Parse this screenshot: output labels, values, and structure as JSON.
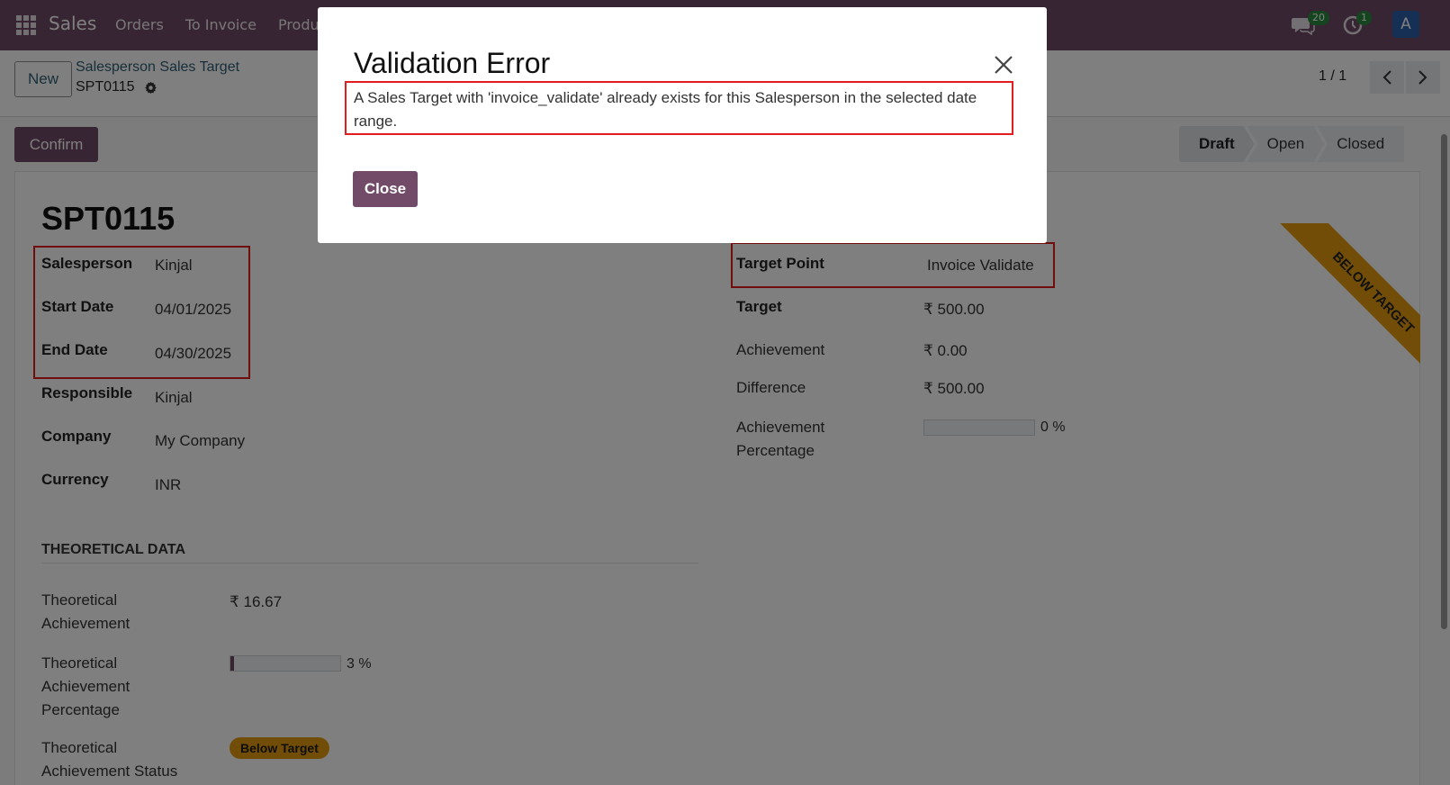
{
  "navbar": {
    "brand": "Sales",
    "menu": [
      "Orders",
      "To Invoice",
      "Produ"
    ],
    "chat_badge": "20",
    "activity_badge": "1",
    "avatar_letter": "A"
  },
  "control_panel": {
    "new_label": "New",
    "breadcrumb": "Salesperson Sales Target",
    "record_name": "SPT0115",
    "pager": "1 / 1"
  },
  "statusbar": {
    "confirm_label": "Confirm",
    "stages": [
      "Draft",
      "Open",
      "Closed"
    ],
    "active_stage": "Draft"
  },
  "form": {
    "title": "SPT0115",
    "ribbon": "BELOW TARGET",
    "left_fields": [
      {
        "label": "Salesperson",
        "value": "Kinjal"
      },
      {
        "label": "Start Date",
        "value": "04/01/2025"
      },
      {
        "label": "End Date",
        "value": "04/30/2025"
      },
      {
        "label": "Responsible",
        "value": "Kinjal"
      },
      {
        "label": "Company",
        "value": "My Company"
      },
      {
        "label": "Currency",
        "value": "INR"
      }
    ],
    "right_fields": [
      {
        "label": "Target Point",
        "value": "Invoice Validate"
      },
      {
        "label": "Target",
        "value": "₹ 500.00"
      },
      {
        "label": "Achievement",
        "value": "₹ 0.00"
      },
      {
        "label": "Difference",
        "value": "₹ 500.00"
      },
      {
        "label": "Achievement Percentage",
        "value": "0 %",
        "progress": 0
      }
    ],
    "theoretical": {
      "section_title": "THEORETICAL DATA",
      "achievement_label": "Theoretical Achievement",
      "achievement_value": "₹ 16.67",
      "percentage_label": "Theoretical Achievement Percentage",
      "percentage_value": "3 %",
      "percentage_progress": 3,
      "status_label": "Theoretical Achievement Status",
      "status_value": "Below Target"
    }
  },
  "dialog": {
    "title": "Validation Error",
    "message": "A Sales Target with 'invoice_validate' already exists for this Salesperson in the selected date range.",
    "close_label": "Close"
  },
  "colors": {
    "brand": "#714b67",
    "warning": "#e49b0f",
    "highlight": "#e11d1d"
  }
}
